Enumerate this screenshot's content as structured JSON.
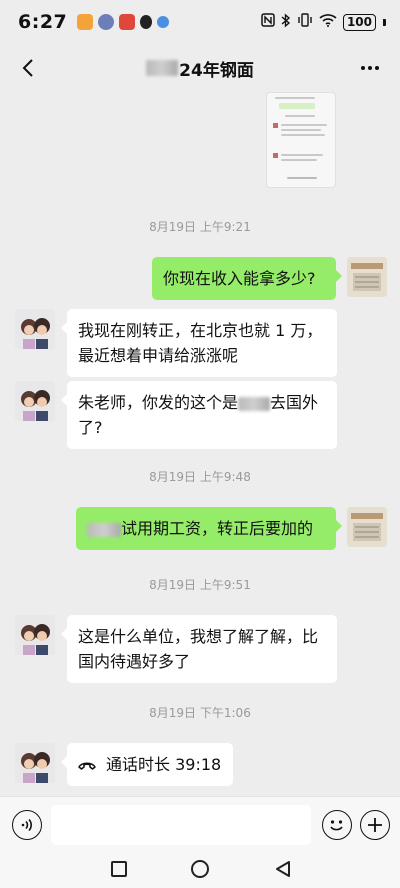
{
  "status_bar": {
    "time": "6:27",
    "battery": "100"
  },
  "header": {
    "title_suffix": "24年钢面"
  },
  "timestamps": [
    "8月19日 上午9:21",
    "8月19日 上午9:48",
    "8月19日 上午9:51",
    "8月19日 下午1:06"
  ],
  "messages": [
    {
      "side": "out",
      "text": "你现在收入能拿多少?"
    },
    {
      "side": "in",
      "lines": [
        "我现在刚转正，在北京也就 1 万，",
        "最近想着申请给涨涨呢"
      ]
    },
    {
      "side": "in",
      "line1_before": "朱老师，你发的这个是",
      "line1_after": "去国外",
      "line2": "了?"
    },
    {
      "side": "out",
      "text": "试用期工资，转正后要加的"
    },
    {
      "side": "in",
      "lines": [
        "这是什么单位，我想了解了解，比",
        "国内待遇好多了"
      ]
    },
    {
      "side": "in",
      "type": "call",
      "text": "通话时长 39:18"
    }
  ],
  "icons": [
    "back-arrow-icon",
    "more-icon",
    "voice-icon",
    "emoji-icon",
    "plus-icon",
    "phone-icon",
    "wifi-icon",
    "nfc-icon",
    "bluetooth-icon",
    "vibrate-icon",
    "battery-icon"
  ],
  "colors": {
    "outgoing_bubble": "#95ec69",
    "incoming_bubble": "#ffffff",
    "background": "#ededed"
  }
}
